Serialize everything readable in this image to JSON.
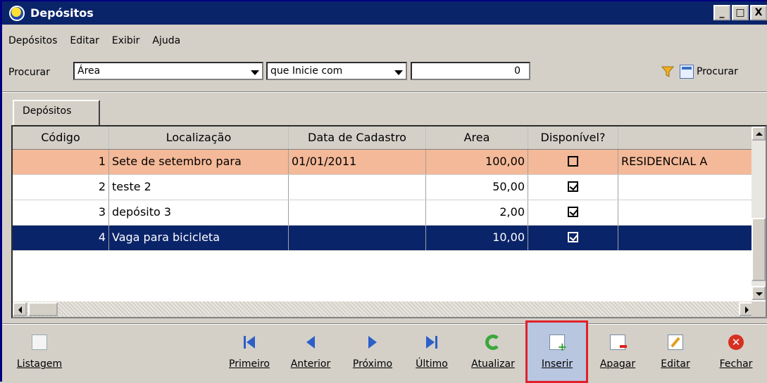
{
  "window": {
    "title": "Depósitos"
  },
  "menu": [
    "Depósitos",
    "Editar",
    "Exibir",
    "Ajuda"
  ],
  "search": {
    "label": "Procurar",
    "field": "Área",
    "mode": "que Inicie com",
    "value": "0",
    "button": "Procurar"
  },
  "tab": "Depósitos",
  "grid": {
    "columns": [
      "Código",
      "Localização",
      "Data de Cadastro",
      "Area",
      "Disponível?",
      ""
    ],
    "rows": [
      {
        "codigo": "1",
        "localizacao": "Sete de setembro para",
        "data": "01/01/2011",
        "area": "100,00",
        "disponivel": false,
        "extra": "RESIDENCIAL A"
      },
      {
        "codigo": "2",
        "localizacao": "teste 2",
        "data": "",
        "area": "50,00",
        "disponivel": true,
        "extra": ""
      },
      {
        "codigo": "3",
        "localizacao": "depósito 3",
        "data": "",
        "area": "2,00",
        "disponivel": true,
        "extra": ""
      },
      {
        "codigo": "4",
        "localizacao": "Vaga para bicicleta",
        "data": "",
        "area": "10,00",
        "disponivel": true,
        "extra": ""
      }
    ]
  },
  "toolbar": {
    "listagem": "Listagem",
    "primeiro": "Primeiro",
    "anterior": "Anterior",
    "proximo": "Próximo",
    "ultimo": "Último",
    "atualizar": "Atualizar",
    "inserir": "Inserir",
    "apagar": "Apagar",
    "editar": "Editar",
    "fechar": "Fechar"
  },
  "colors": {
    "titlebar": "#0a246a",
    "selected_row": "#0a246a",
    "highlight_row": "#f4b998",
    "highlight_border": "#e0202a"
  }
}
